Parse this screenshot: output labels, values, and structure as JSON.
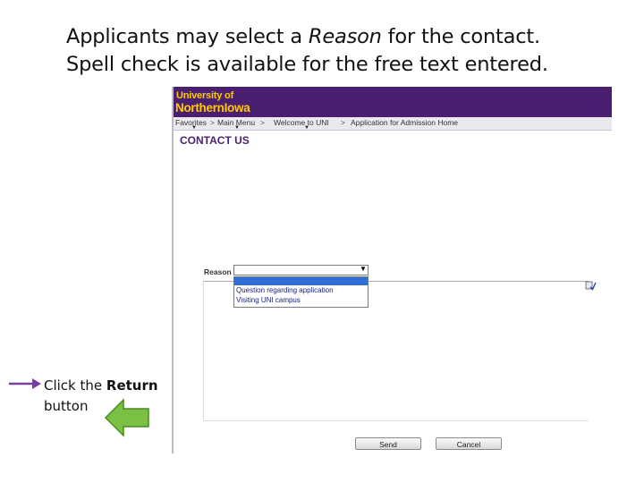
{
  "slide": {
    "line1_prefix": "Applicants may select a ",
    "line1_italic": "Reason",
    "line1_suffix": " for the contact.",
    "line2": "Spell check is available for the free text entered."
  },
  "app": {
    "logo_line1": "University of",
    "logo_line2": "NorthernIowa",
    "brand_color": "#4b1f6f",
    "logo_color": "#ffcc00",
    "nav": [
      "Favorites",
      "Main Menu",
      "Welcome to UNI",
      "Application for Admission Home"
    ],
    "nav_separator": ">",
    "heading": "CONTACT US"
  },
  "form": {
    "reason_label": "Reason",
    "reason_value": "",
    "reason_options": [
      "",
      "Question regarding application",
      "Visiting UNI campus"
    ],
    "message_value": "",
    "send_label": "Send",
    "cancel_label": "Cancel"
  },
  "callout": {
    "text_prefix": "Click the ",
    "text_bold": "Return",
    "text_suffix": "button",
    "arrow_color": "#7b3f9e",
    "green_arrow_color": "#7ac143"
  }
}
